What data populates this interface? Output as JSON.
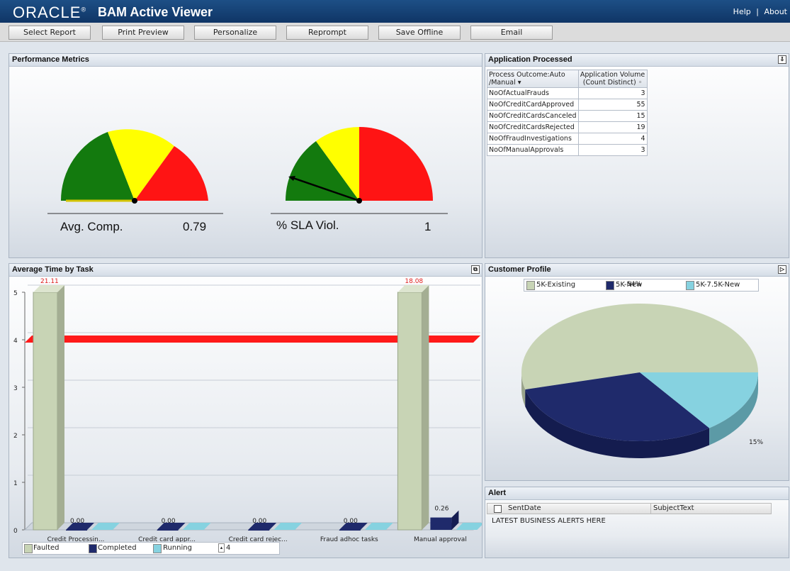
{
  "header": {
    "logo": "ORACLE",
    "title": "BAM Active Viewer",
    "links": [
      "Help",
      "About"
    ],
    "separator": "|"
  },
  "toolbar": {
    "buttons": [
      "Select Report",
      "Print Preview",
      "Personalize",
      "Reprompt",
      "Save Offline",
      "Email"
    ]
  },
  "colors": {
    "green": "#137a0e",
    "yellow": "#ffff00",
    "red": "#ff1414",
    "faulted": "#c8d4b5",
    "completed": "#1f2a6b",
    "running": "#86d2e0"
  },
  "performance_metrics": {
    "title": "Performance Metrics",
    "gauges": [
      {
        "label": "Avg. Comp.",
        "value": "0.79",
        "needle_fraction": 0.0
      },
      {
        "label": "% SLA Viol.",
        "value": "1",
        "needle_fraction": 0.14
      }
    ]
  },
  "application_processed": {
    "title": "Application Processed",
    "col1_header": "Process Outcome:Auto /Manual",
    "col2_header": "Application Volume (Count Distinct)",
    "rows": [
      {
        "name": "NoOfActualFrauds",
        "value": "3"
      },
      {
        "name": "NoOfCreditCardApproved",
        "value": "55"
      },
      {
        "name": "NoOfCreditCardsCanceled",
        "value": "15"
      },
      {
        "name": "NoOfCreditCardsRejected",
        "value": "19"
      },
      {
        "name": "NoOfFraudInvestigations",
        "value": "4"
      },
      {
        "name": "NoOfManualApprovals",
        "value": "3"
      }
    ]
  },
  "average_time": {
    "title": "Average Time by Task",
    "legend_spin_value": "4"
  },
  "customer_profile": {
    "title": "Customer Profile"
  },
  "alert": {
    "title": "Alert",
    "columns": [
      "SentDate",
      "SubjectText"
    ],
    "message": "LATEST BUSINESS ALERTS HERE"
  },
  "chart_data": [
    {
      "type": "bar",
      "categories": [
        "Credit Processin...",
        "Credit card appr...",
        "Credit card rejec...",
        "Fraud adhoc tasks",
        "Manual approval"
      ],
      "series": [
        {
          "name": "Faulted",
          "values": [
            21.11,
            null,
            null,
            null,
            18.08
          ],
          "labels": [
            "21.11",
            "",
            "",
            "",
            "18.08"
          ]
        },
        {
          "name": "Completed",
          "values": [
            0,
            0,
            0,
            0,
            0.26
          ],
          "labels": [
            "0.00",
            "0.00",
            "0.00",
            "0.00",
            "0.26"
          ]
        },
        {
          "name": "Running",
          "values": [
            0,
            0,
            0,
            0,
            0
          ]
        }
      ],
      "reference_line": 4,
      "ylim": [
        0,
        5
      ],
      "yticks": [
        "0",
        "1",
        "2",
        "3",
        "4",
        "5"
      ]
    },
    {
      "type": "pie",
      "labels": [
        "5K-Existing",
        "5K-New",
        "5K-7.5K-New"
      ],
      "values": [
        54,
        31,
        15
      ],
      "value_labels": [
        "54%",
        "31%",
        "15%"
      ]
    }
  ]
}
